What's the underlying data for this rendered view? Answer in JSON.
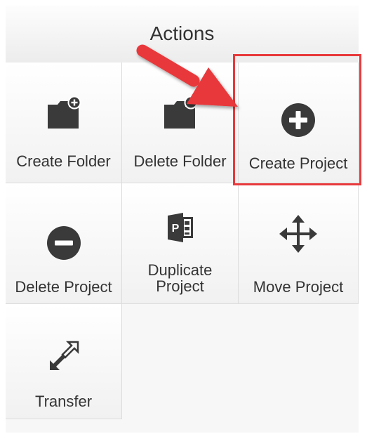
{
  "header": {
    "title": "Actions"
  },
  "tiles": {
    "create_folder": {
      "label": "Create Folder",
      "icon": "create-folder-icon"
    },
    "delete_folder": {
      "label": "Delete Folder",
      "icon": "delete-folder-icon"
    },
    "create_project": {
      "label": "Create Project",
      "icon": "plus-circle-icon"
    },
    "delete_project": {
      "label": "Delete Project",
      "icon": "minus-circle-icon"
    },
    "duplicate_project": {
      "label_line1": "Duplicate",
      "label_line2": "Project",
      "icon": "duplicate-project-icon"
    },
    "move_project": {
      "label": "Move Project",
      "icon": "move-arrows-icon"
    },
    "transfer": {
      "label": "Transfer",
      "icon": "transfer-arrows-icon"
    }
  },
  "annotation": {
    "highlight_color": "#e8393b",
    "arrow_color": "#e8393b",
    "highlighted": "create_project"
  },
  "colors": {
    "icon": "#3a3a3a",
    "text": "#333333"
  }
}
